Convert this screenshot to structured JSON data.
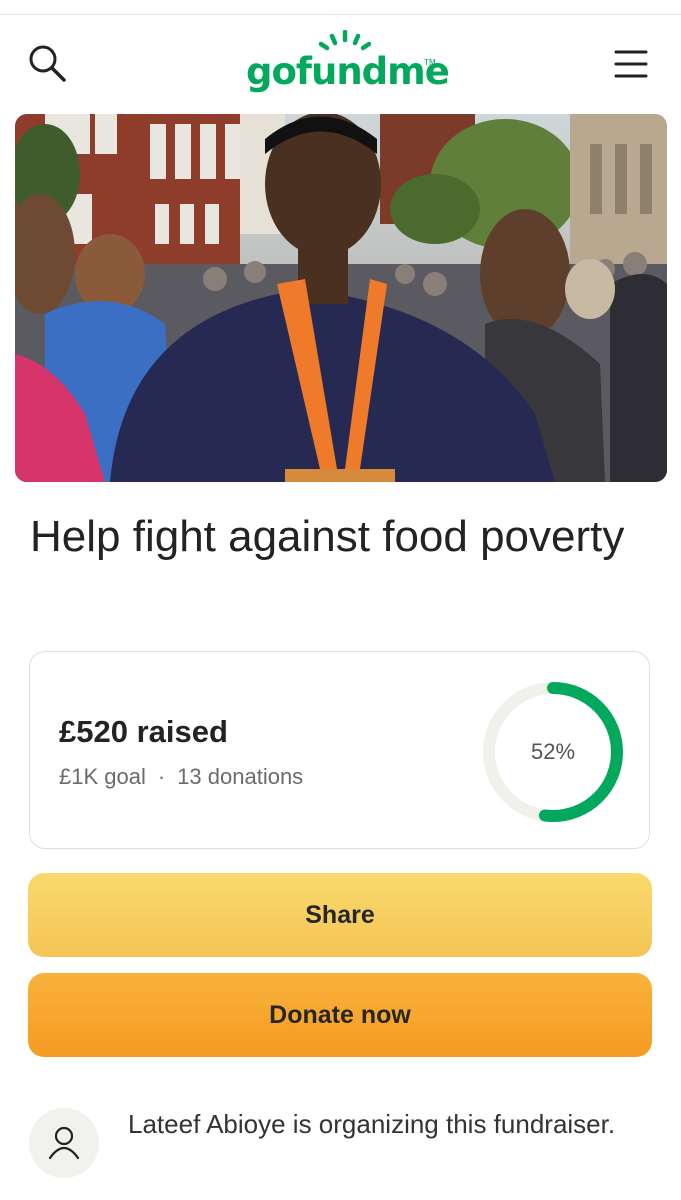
{
  "header": {
    "logo_text": "gofundme",
    "logo_tm": "TM",
    "brand_color": "#02a95c"
  },
  "campaign": {
    "title": "Help fight against food poverty",
    "raised": "£520 raised",
    "goal": "£1K goal",
    "separator": "·",
    "donations": "13 donations",
    "progress_label": "52%",
    "progress_fraction": 0.52,
    "progress_color": "#02a95c"
  },
  "actions": {
    "share_label": "Share",
    "donate_label": "Donate now"
  },
  "organizer": {
    "text": "Lateef Abioye is organizing this fundraiser."
  },
  "icons": {
    "search": "search-icon",
    "menu": "menu-icon",
    "avatar": "user-icon"
  }
}
